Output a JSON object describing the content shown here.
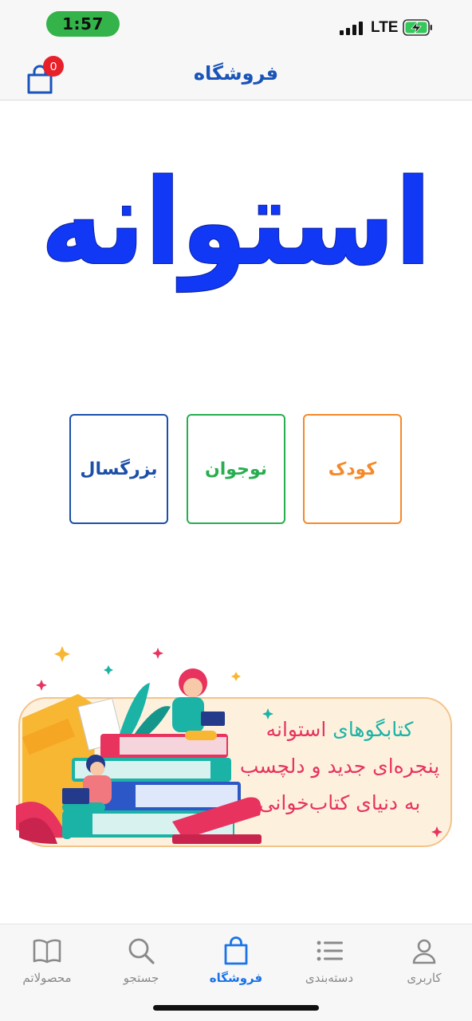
{
  "status_bar": {
    "time": "1:57",
    "network": "LTE",
    "battery_charging": true
  },
  "header": {
    "title": "فروشگاه",
    "cart_count": "0"
  },
  "logo": {
    "text": "استوانه",
    "color": "#1038f5"
  },
  "categories": [
    {
      "label": "کودک",
      "color": "#f5892a"
    },
    {
      "label": "نوجوان",
      "color": "#27ae4f"
    },
    {
      "label": "بزرگسال",
      "color": "#1c4fa8"
    }
  ],
  "banner": {
    "line1_prefix": "کتابگوهای",
    "line1_suffix": "استوانه",
    "line2": "پنجره‌ای جدید و دلچسب",
    "line3": "به دنیای کتاب‌خوانی"
  },
  "bottom_nav": [
    {
      "label": "کاربری",
      "icon": "user-icon",
      "active": false
    },
    {
      "label": "دسته‌بندی",
      "icon": "list-icon",
      "active": false
    },
    {
      "label": "فروشگاه",
      "icon": "shopping-bag-icon",
      "active": true
    },
    {
      "label": "جستجو",
      "icon": "search-icon",
      "active": false
    },
    {
      "label": "محصولاتم",
      "icon": "book-icon",
      "active": false
    }
  ],
  "colors": {
    "accent": "#1a73e8",
    "header_title": "#1a54b8",
    "badge": "#e8202a",
    "banner_pink": "#e7335e",
    "banner_teal": "#1bb3a6"
  }
}
